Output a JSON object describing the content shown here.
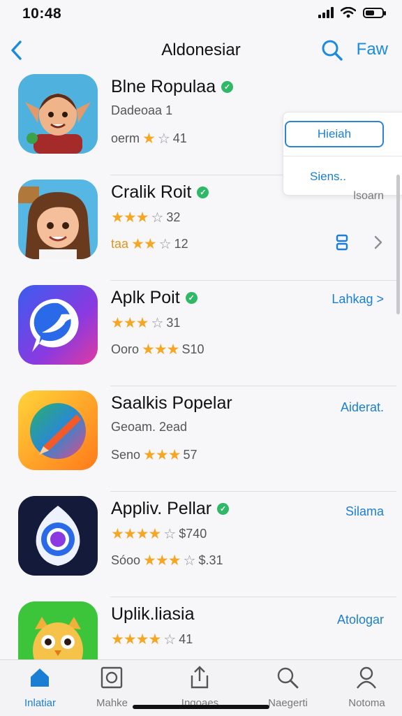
{
  "status": {
    "time": "10:48"
  },
  "nav": {
    "title": "Aldonesiar",
    "action": "Faw"
  },
  "apps": [
    {
      "name": "Blne Ropulaa",
      "line1_text": "Dadeoaa 1",
      "line2_prefix": "oerm",
      "line2_stars": "★",
      "line2_empty": "☆",
      "line2_value": "41",
      "action": ""
    },
    {
      "name": "Cralik Roit",
      "line1_stars": "★★★",
      "line1_empty": "☆",
      "line1_value": "32",
      "line2_prefix": "taa",
      "line2_stars": "★★",
      "line2_empty": "☆",
      "line2_value": "12",
      "action": ""
    },
    {
      "name": "Aplk Poit",
      "line1_stars": "★★★",
      "line1_empty": "☆",
      "line1_value": "31",
      "line2_prefix": "Ooro",
      "line2_stars": "★★★",
      "line2_value": "S10",
      "action": "Lahkag >"
    },
    {
      "name": "Saalkis Popelar",
      "line1_text": "Geoam. 2ead",
      "line2_prefix": "Seno",
      "line2_stars": "★★★",
      "line2_value": "57",
      "action": "Aiderat."
    },
    {
      "name": "Appliv. Pellar",
      "line1_stars": "★★★★",
      "line1_empty": "☆",
      "line1_value": "$740",
      "line2_prefix": "Sóoo",
      "line2_stars": "★★★",
      "line2_empty": "☆",
      "line2_value": "$.31",
      "action": "Silama"
    },
    {
      "name": "Uplik.liasia",
      "line1_stars": "★★★★",
      "line1_empty": "☆",
      "line1_value": "41",
      "action": "Atologar"
    }
  ],
  "popup": {
    "button": "Hieiah",
    "item": "Siens..",
    "extra": "lsoarn"
  },
  "tabs": [
    {
      "label": "Inlatiar"
    },
    {
      "label": "Mahke"
    },
    {
      "label": "Ingoaes"
    },
    {
      "label": "Naegerti"
    },
    {
      "label": "Notoma"
    }
  ],
  "colors": {
    "accent": "#1a7fd4",
    "star": "#f5a623",
    "verified": "#2fb865"
  }
}
